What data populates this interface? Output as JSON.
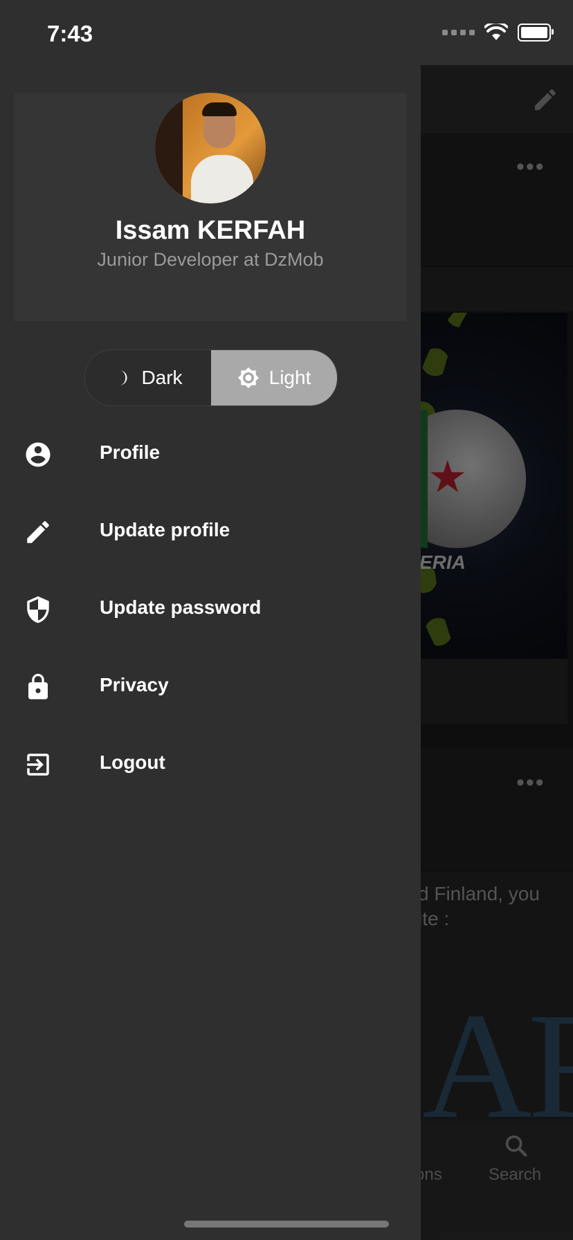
{
  "status_bar": {
    "time": "7:43"
  },
  "drawer": {
    "user": {
      "name": "Issam KERFAH",
      "title": "Junior Developer at DzMob"
    },
    "theme_toggle": {
      "dark_label": "Dark",
      "light_label": "Light",
      "selected": "Light"
    },
    "menu": [
      {
        "label": "Profile",
        "icon": "account-circle-icon"
      },
      {
        "label": "Update profile",
        "icon": "pencil-icon"
      },
      {
        "label": "Update password",
        "icon": "shield-icon"
      },
      {
        "label": "Privacy",
        "icon": "lock-icon"
      },
      {
        "label": "Logout",
        "icon": "logout-icon"
      }
    ]
  },
  "background": {
    "image_text": "ERIA",
    "post_text": "d Finland, you\nite :",
    "logo_text": "AR",
    "bottom_nav": {
      "partial_label": "ons",
      "search_label": "Search"
    }
  },
  "colors": {
    "drawer_bg": "#2f2f2f",
    "header_bg": "#353535",
    "toggle_selected": "#a9a9a9",
    "toggle_unselected": "#2c2c2c"
  }
}
